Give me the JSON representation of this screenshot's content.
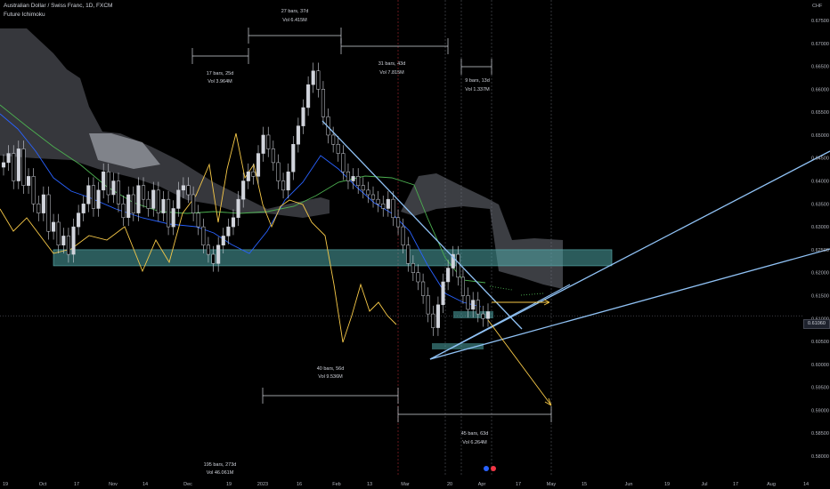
{
  "header": {
    "symbol": "Australian Dollar / Swiss Franc, 1D, FXCM",
    "indicator": "Future Ichimoku"
  },
  "currency_label": "CHF",
  "last_price": "0.61060",
  "annotations": [
    {
      "id": "a1",
      "line1": "27 bars, 37d",
      "line2": "Vol 6.415M"
    },
    {
      "id": "a2",
      "line1": "17 bars, 25d",
      "line2": "Vol 3.964M"
    },
    {
      "id": "a3",
      "line1": "31 bars, 43d",
      "line2": "Vol 7.815M"
    },
    {
      "id": "a4",
      "line1": "9 bars, 13d",
      "line2": "Vol 1.337M"
    },
    {
      "id": "a5",
      "line1": "40 bars, 56d",
      "line2": "Vol 9.536M"
    },
    {
      "id": "a6",
      "line1": "45 bars, 63d",
      "line2": "Vol 6.264M"
    },
    {
      "id": "a7",
      "line1": "195 bars, 273d",
      "line2": "Vol 46.061M"
    }
  ],
  "chart_data": {
    "type": "candlestick",
    "y_axis": {
      "ticks": [
        "0.67500",
        "0.67000",
        "0.66500",
        "0.66000",
        "0.65500",
        "0.65000",
        "0.64500",
        "0.64000",
        "0.63500",
        "0.63000",
        "0.62500",
        "0.62000",
        "0.61500",
        "0.61000",
        "0.60500",
        "0.60000",
        "0.59500",
        "0.59000",
        "0.58500",
        "0.58000"
      ],
      "range": [
        0.5775,
        0.6795
      ]
    },
    "x_axis": {
      "ticks": [
        "19",
        "Oct",
        "17",
        "Nov",
        "14",
        "Dec",
        "19",
        "2023",
        "16",
        "Feb",
        "13",
        "Mar",
        "20",
        "Apr",
        "17",
        "May",
        "15",
        "Jun",
        "19",
        "Jul",
        "17",
        "Aug",
        "14"
      ]
    },
    "support_zone": {
      "low": 0.6215,
      "high": 0.625
    },
    "candles_close_path": [
      0.644,
      0.646,
      0.64,
      0.647,
      0.639,
      0.641,
      0.635,
      0.633,
      0.637,
      0.629,
      0.631,
      0.626,
      0.628,
      0.624,
      0.63,
      0.633,
      0.635,
      0.639,
      0.634,
      0.638,
      0.642,
      0.637,
      0.64,
      0.635,
      0.632,
      0.637,
      0.633,
      0.639,
      0.636,
      0.634,
      0.638,
      0.633,
      0.636,
      0.63,
      0.634,
      0.638,
      0.639,
      0.637,
      0.633,
      0.63,
      0.626,
      0.624,
      0.622,
      0.626,
      0.628,
      0.63,
      0.632,
      0.636,
      0.64,
      0.642,
      0.641,
      0.646,
      0.65,
      0.647,
      0.644,
      0.64,
      0.638,
      0.642,
      0.648,
      0.652,
      0.656,
      0.661,
      0.664,
      0.66,
      0.654,
      0.65,
      0.648,
      0.646,
      0.642,
      0.64,
      0.641,
      0.639,
      0.638,
      0.637,
      0.636,
      0.635,
      0.634,
      0.636,
      0.632,
      0.63,
      0.626,
      0.622,
      0.62,
      0.618,
      0.615,
      0.611,
      0.608,
      0.613,
      0.618,
      0.621,
      0.624,
      0.619,
      0.615,
      0.612,
      0.614,
      0.611,
      0.61,
      0.6115
    ]
  }
}
